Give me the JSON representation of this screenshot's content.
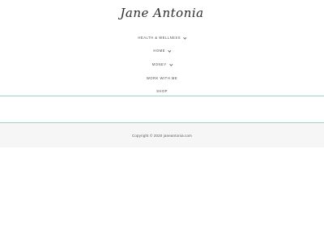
{
  "site": {
    "logo_text": "Jane Antonia"
  },
  "nav": {
    "items": [
      {
        "label": "HEALTH & WELLNESS",
        "has_submenu": true
      },
      {
        "label": "HOME",
        "has_submenu": true
      },
      {
        "label": "MONEY",
        "has_submenu": true
      },
      {
        "label": "WORK WITH ME",
        "has_submenu": false
      },
      {
        "label": "SHOP",
        "has_submenu": false
      }
    ]
  },
  "footer": {
    "copyright": "Copyright © 2020 janeantonia.com"
  },
  "colors": {
    "accent_line": "#9fd3c7",
    "footer_bg": "#f6f6f6"
  }
}
